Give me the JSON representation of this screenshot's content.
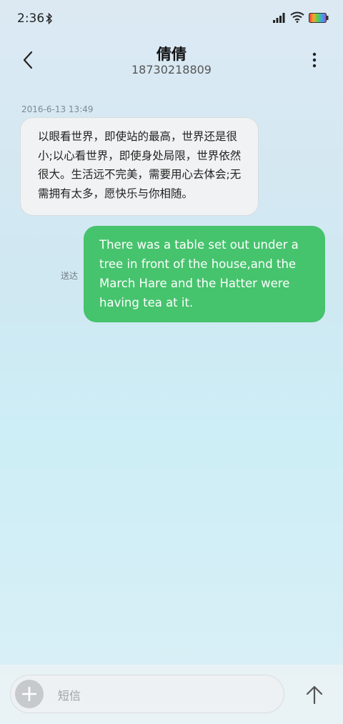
{
  "status_bar": {
    "time": "2:36",
    "icons": [
      "bluetooth-icon",
      "signal-icon",
      "wifi-icon",
      "battery-icon"
    ]
  },
  "header": {
    "contact_name": "倩倩",
    "contact_number": "18730218809",
    "back_icon": "chevron-left-icon",
    "more_icon": "more-vertical-icon"
  },
  "conversation": {
    "timestamp": "2016-6-13 13:49",
    "messages": [
      {
        "direction": "incoming",
        "text": "以眼看世界，即使站的最高，世界还是很小;以心看世界，即使身处局限，世界依然很大。生活远不完美，需要用心去体会;无需拥有太多，愿快乐与你相随。"
      },
      {
        "direction": "outgoing",
        "text": "There was a table set out under a tree in front of the house,and the March Hare and the Hatter were having tea at it.",
        "status": "送达"
      }
    ]
  },
  "composer": {
    "placeholder": "短信",
    "value": "",
    "add_icon": "plus-icon",
    "send_icon": "arrow-up-icon"
  },
  "colors": {
    "outgoing_bubble": "#46c36d",
    "incoming_bubble": "#f1f2f3"
  }
}
